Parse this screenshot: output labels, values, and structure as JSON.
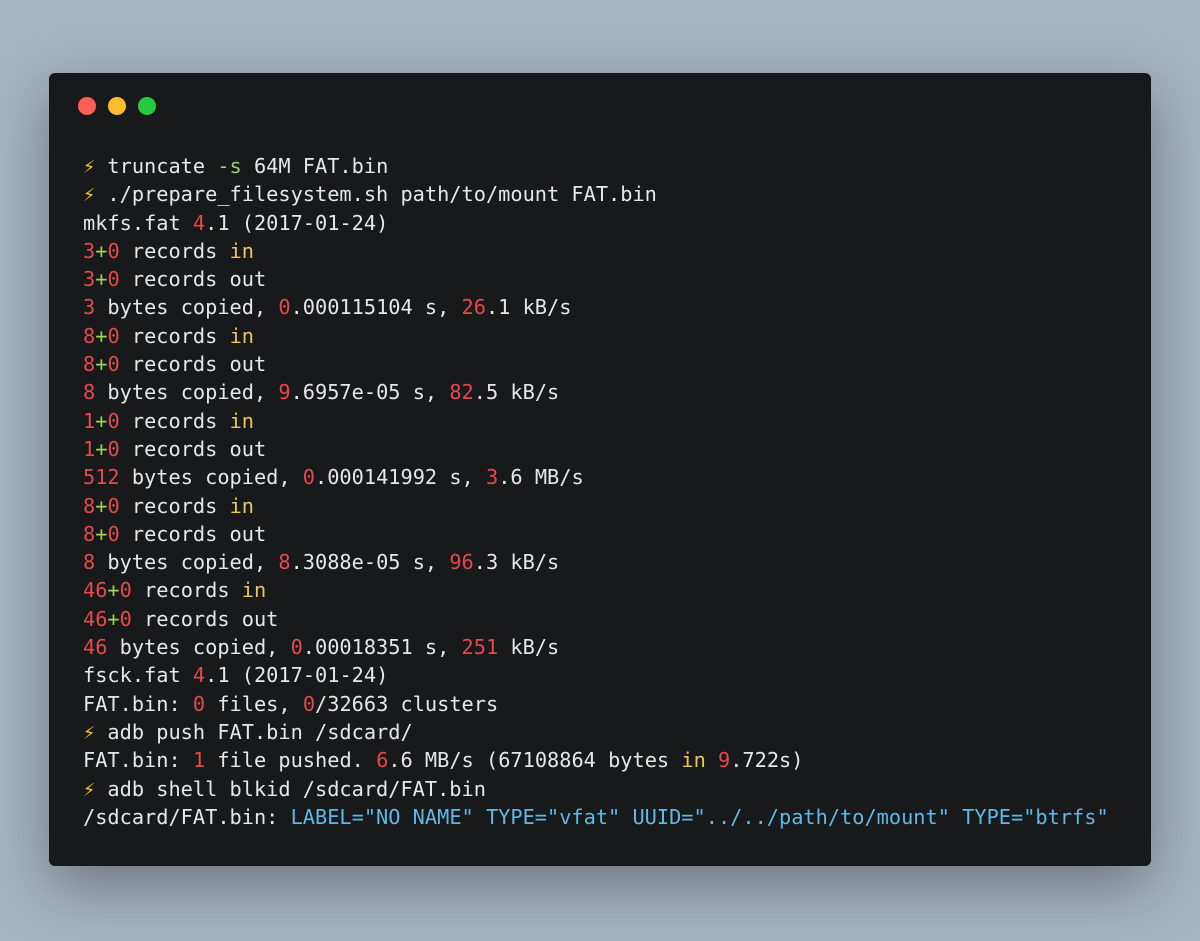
{
  "window": {
    "traffic_lights": [
      {
        "name": "close",
        "color": "#ff5f56"
      },
      {
        "name": "minimize",
        "color": "#ffbd2e"
      },
      {
        "name": "zoom",
        "color": "#27c93f"
      }
    ]
  },
  "colors": {
    "background": "#a8b4c1",
    "terminal": "#18191b",
    "text": "#e6e6e6",
    "number": "#e5484d",
    "keyword": "#e8c65a",
    "plus": "#9bd35a",
    "attribute": "#5fb8e6",
    "prompt": "#f0c23a"
  },
  "lines": [
    [
      {
        "t": "⚡ ",
        "c": "prompt"
      },
      {
        "t": "truncate ",
        "c": "default"
      },
      {
        "t": "-s",
        "c": "flag"
      },
      {
        "t": " 64M FAT.bin",
        "c": "default"
      }
    ],
    [
      {
        "t": "⚡ ",
        "c": "prompt"
      },
      {
        "t": "./prepare_filesystem.sh path/to/mount FAT.bin",
        "c": "default"
      }
    ],
    [
      {
        "t": "mkfs.fat ",
        "c": "default"
      },
      {
        "t": "4",
        "c": "num"
      },
      {
        "t": ".1 (2017-01-24)",
        "c": "default"
      }
    ],
    [
      {
        "t": "3",
        "c": "num"
      },
      {
        "t": "+",
        "c": "plus"
      },
      {
        "t": "0",
        "c": "num"
      },
      {
        "t": " records ",
        "c": "default"
      },
      {
        "t": "in",
        "c": "kw"
      }
    ],
    [
      {
        "t": "3",
        "c": "num"
      },
      {
        "t": "+",
        "c": "plus"
      },
      {
        "t": "0",
        "c": "num"
      },
      {
        "t": " records out",
        "c": "default"
      }
    ],
    [
      {
        "t": "3",
        "c": "num"
      },
      {
        "t": " bytes copied, ",
        "c": "default"
      },
      {
        "t": "0",
        "c": "num"
      },
      {
        "t": ".000115104 s, ",
        "c": "default"
      },
      {
        "t": "26",
        "c": "num"
      },
      {
        "t": ".1 kB/s",
        "c": "default"
      }
    ],
    [
      {
        "t": "8",
        "c": "num"
      },
      {
        "t": "+",
        "c": "plus"
      },
      {
        "t": "0",
        "c": "num"
      },
      {
        "t": " records ",
        "c": "default"
      },
      {
        "t": "in",
        "c": "kw"
      }
    ],
    [
      {
        "t": "8",
        "c": "num"
      },
      {
        "t": "+",
        "c": "plus"
      },
      {
        "t": "0",
        "c": "num"
      },
      {
        "t": " records out",
        "c": "default"
      }
    ],
    [
      {
        "t": "8",
        "c": "num"
      },
      {
        "t": " bytes copied, ",
        "c": "default"
      },
      {
        "t": "9",
        "c": "num"
      },
      {
        "t": ".6957e-05 s, ",
        "c": "default"
      },
      {
        "t": "82",
        "c": "num"
      },
      {
        "t": ".5 kB/s",
        "c": "default"
      }
    ],
    [
      {
        "t": "1",
        "c": "num"
      },
      {
        "t": "+",
        "c": "plus"
      },
      {
        "t": "0",
        "c": "num"
      },
      {
        "t": " records ",
        "c": "default"
      },
      {
        "t": "in",
        "c": "kw"
      }
    ],
    [
      {
        "t": "1",
        "c": "num"
      },
      {
        "t": "+",
        "c": "plus"
      },
      {
        "t": "0",
        "c": "num"
      },
      {
        "t": " records out",
        "c": "default"
      }
    ],
    [
      {
        "t": "512",
        "c": "num"
      },
      {
        "t": " bytes copied, ",
        "c": "default"
      },
      {
        "t": "0",
        "c": "num"
      },
      {
        "t": ".000141992 s, ",
        "c": "default"
      },
      {
        "t": "3",
        "c": "num"
      },
      {
        "t": ".6 MB/s",
        "c": "default"
      }
    ],
    [
      {
        "t": "8",
        "c": "num"
      },
      {
        "t": "+",
        "c": "plus"
      },
      {
        "t": "0",
        "c": "num"
      },
      {
        "t": " records ",
        "c": "default"
      },
      {
        "t": "in",
        "c": "kw"
      }
    ],
    [
      {
        "t": "8",
        "c": "num"
      },
      {
        "t": "+",
        "c": "plus"
      },
      {
        "t": "0",
        "c": "num"
      },
      {
        "t": " records out",
        "c": "default"
      }
    ],
    [
      {
        "t": "8",
        "c": "num"
      },
      {
        "t": " bytes copied, ",
        "c": "default"
      },
      {
        "t": "8",
        "c": "num"
      },
      {
        "t": ".3088e-05 s, ",
        "c": "default"
      },
      {
        "t": "96",
        "c": "num"
      },
      {
        "t": ".3 kB/s",
        "c": "default"
      }
    ],
    [
      {
        "t": "46",
        "c": "num"
      },
      {
        "t": "+",
        "c": "plus"
      },
      {
        "t": "0",
        "c": "num"
      },
      {
        "t": " records ",
        "c": "default"
      },
      {
        "t": "in",
        "c": "kw"
      }
    ],
    [
      {
        "t": "46",
        "c": "num"
      },
      {
        "t": "+",
        "c": "plus"
      },
      {
        "t": "0",
        "c": "num"
      },
      {
        "t": " records out",
        "c": "default"
      }
    ],
    [
      {
        "t": "46",
        "c": "num"
      },
      {
        "t": " bytes copied, ",
        "c": "default"
      },
      {
        "t": "0",
        "c": "num"
      },
      {
        "t": ".00018351 s, ",
        "c": "default"
      },
      {
        "t": "251",
        "c": "num"
      },
      {
        "t": " kB/s",
        "c": "default"
      }
    ],
    [
      {
        "t": "fsck.fat ",
        "c": "default"
      },
      {
        "t": "4",
        "c": "num"
      },
      {
        "t": ".1 (2017-01-24)",
        "c": "default"
      }
    ],
    [
      {
        "t": "FAT.bin: ",
        "c": "default"
      },
      {
        "t": "0",
        "c": "num"
      },
      {
        "t": " files, ",
        "c": "default"
      },
      {
        "t": "0",
        "c": "num"
      },
      {
        "t": "/32663 clusters",
        "c": "default"
      }
    ],
    [
      {
        "t": "⚡ ",
        "c": "prompt"
      },
      {
        "t": "adb push FAT.bin /sdcard/",
        "c": "default"
      }
    ],
    [
      {
        "t": "FAT.bin: ",
        "c": "default"
      },
      {
        "t": "1",
        "c": "num"
      },
      {
        "t": " file pushed. ",
        "c": "default"
      },
      {
        "t": "6",
        "c": "num"
      },
      {
        "t": ".6 MB/s (67108864 bytes ",
        "c": "default"
      },
      {
        "t": "in",
        "c": "kw"
      },
      {
        "t": " ",
        "c": "default"
      },
      {
        "t": "9",
        "c": "num"
      },
      {
        "t": ".722s)",
        "c": "default"
      }
    ],
    [
      {
        "t": "⚡ ",
        "c": "prompt"
      },
      {
        "t": "adb shell blkid /sdcard/FAT.bin",
        "c": "default"
      }
    ],
    [
      {
        "t": "/sdcard/FAT.bin: ",
        "c": "default"
      },
      {
        "t": "LABEL=\"NO NAME\" TYPE=\"vfat\" UUID=\"../../path/to/mount\" TYPE=\"btrfs\"",
        "c": "attr"
      }
    ]
  ]
}
